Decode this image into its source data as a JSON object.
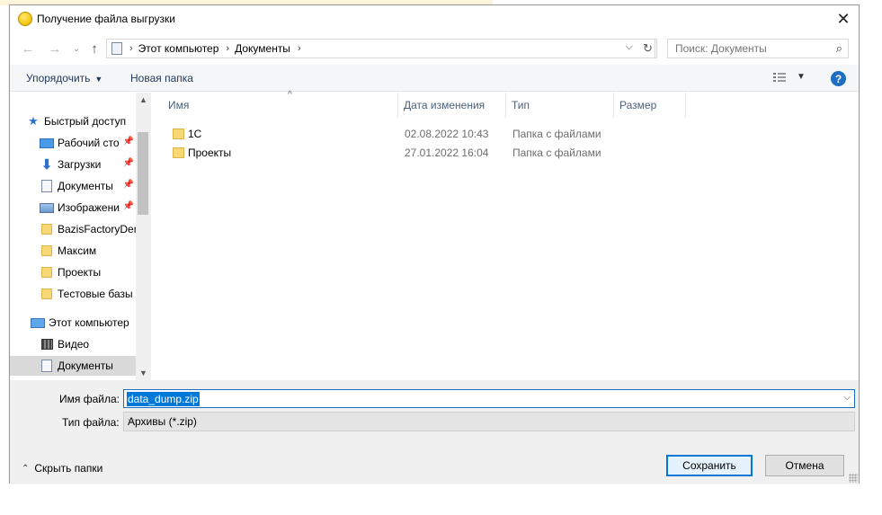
{
  "dialog": {
    "title": "Получение файла выгрузки",
    "close_glyph": "✕"
  },
  "address": {
    "crumbs": [
      "Этот компьютер",
      "Документы"
    ],
    "search_placeholder": "Поиск: Документы"
  },
  "toolbar": {
    "organize_label": "Упорядочить",
    "new_folder_label": "Новая папка",
    "help_glyph": "?"
  },
  "nav": {
    "quick_access": "Быстрый доступ",
    "items": [
      {
        "label": "Рабочий сто",
        "icon": "desktop-icon",
        "pinned": true
      },
      {
        "label": "Загрузки",
        "icon": "downloads-icon",
        "pinned": true
      },
      {
        "label": "Документы",
        "icon": "documents-icon",
        "pinned": true
      },
      {
        "label": "Изображени",
        "icon": "pictures-icon",
        "pinned": true
      },
      {
        "label": "BazisFactoryDem",
        "icon": "folder-icon",
        "pinned": false
      },
      {
        "label": "Максим",
        "icon": "folder-icon",
        "pinned": false
      },
      {
        "label": "Проекты",
        "icon": "folder-icon",
        "pinned": false
      },
      {
        "label": "Тестовые базы",
        "icon": "folder-icon",
        "pinned": false
      }
    ],
    "this_pc": "Этот компьютер",
    "pc_items": [
      {
        "label": "Видео",
        "icon": "video-icon"
      },
      {
        "label": "Документы",
        "icon": "documents-icon",
        "selected": true
      }
    ]
  },
  "list": {
    "columns": [
      "Имя",
      "Дата изменения",
      "Тип",
      "Размер"
    ],
    "rows": [
      {
        "name": "1С",
        "date": "02.08.2022 10:43",
        "type": "Папка с файлами",
        "size": ""
      },
      {
        "name": "Проекты",
        "date": "27.01.2022 16:04",
        "type": "Папка с файлами",
        "size": ""
      }
    ]
  },
  "bottom": {
    "filename_label": "Имя файла:",
    "filename_value": "data_dump.zip",
    "filetype_label": "Тип файла:",
    "filetype_value": "Архивы (*.zip)",
    "hide_folders_label": "Скрыть папки",
    "save_label": "Сохранить",
    "cancel_label": "Отмена"
  },
  "colors": {
    "accent": "#0078d7",
    "help": "#1c6fc4",
    "folder": "#f8d775"
  }
}
